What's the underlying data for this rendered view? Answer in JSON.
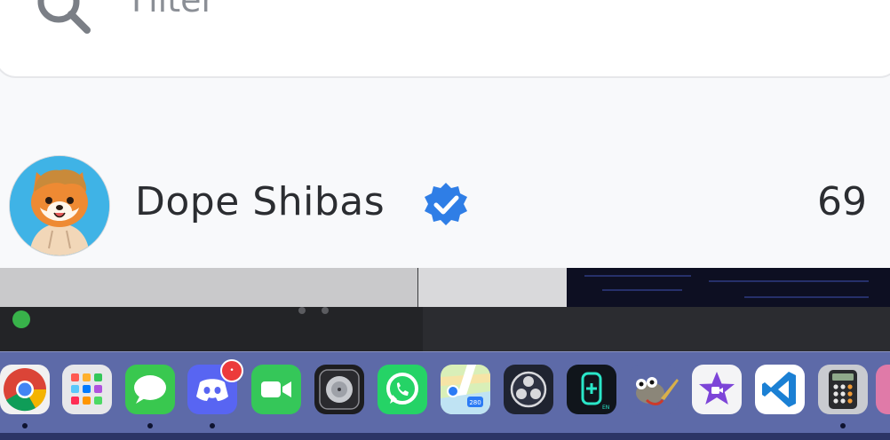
{
  "search": {
    "placeholder": "Filter",
    "value": ""
  },
  "results": [
    {
      "name": "Dope Shibas",
      "verified": true,
      "count": "69"
    }
  ],
  "dock": {
    "apps": [
      {
        "name": "chrome-icon",
        "running": true
      },
      {
        "name": "launchpad-icon",
        "running": false
      },
      {
        "name": "messages-icon",
        "running": true
      },
      {
        "name": "discord-icon",
        "running": true,
        "badge": "•"
      },
      {
        "name": "facetime-icon",
        "running": false
      },
      {
        "name": "logic-pro-icon",
        "running": false
      },
      {
        "name": "whatsapp-icon",
        "running": false
      },
      {
        "name": "maps-icon",
        "running": false
      },
      {
        "name": "obs-icon",
        "running": false
      },
      {
        "name": "theta-wallet-icon",
        "running": false
      },
      {
        "name": "gimp-icon",
        "running": false
      },
      {
        "name": "imovie-icon",
        "running": false
      },
      {
        "name": "vscode-icon",
        "running": false
      },
      {
        "name": "calculator-icon",
        "running": true
      }
    ]
  },
  "colors": {
    "verified": "#2f7ee6",
    "dock": "#5d6aa8",
    "badge": "#ec3b3b"
  }
}
